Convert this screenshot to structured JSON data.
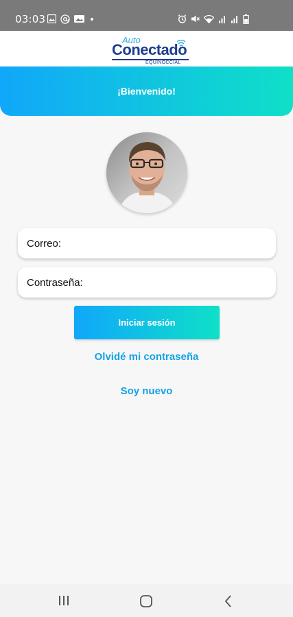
{
  "status_bar": {
    "time": "03:03",
    "left_icons": [
      "image-icon",
      "at-sign-icon",
      "gallery-icon",
      "dot-icon"
    ],
    "right_icons": [
      "alarm-icon",
      "mute-icon",
      "wifi-icon",
      "signal-icon",
      "signal-icon",
      "battery-icon"
    ]
  },
  "header": {
    "logo_top": "Auto",
    "logo_main": "Conectado",
    "logo_sub": "EQUINOCCIAL"
  },
  "banner": {
    "title": "¡Bienvenido!"
  },
  "form": {
    "email_label": "Correo:",
    "password_label": "Contraseña:",
    "login_button": "Iniciar sesión",
    "forgot_link": "Olvidé mi contraseña",
    "new_user_link": "Soy nuevo"
  },
  "nav_bar": {
    "buttons": [
      "recent-apps-icon",
      "home-icon",
      "back-icon"
    ]
  },
  "colors": {
    "gradient_start": "#10a7fa",
    "gradient_end": "#0fe0c8",
    "link": "#14a3e6",
    "logo_blue": "#1f3e8e"
  }
}
